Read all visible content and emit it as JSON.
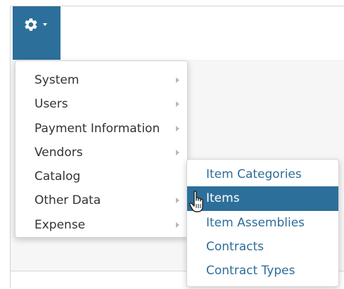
{
  "toolbar": {
    "settings_icon": "gear-icon",
    "dropdown_icon": "caret-down-icon",
    "accent_color": "#2c6f9a"
  },
  "main_menu": {
    "items": [
      {
        "label": "System",
        "has_submenu": true
      },
      {
        "label": "Users",
        "has_submenu": true
      },
      {
        "label": "Payment Information",
        "has_submenu": true
      },
      {
        "label": "Vendors",
        "has_submenu": true
      },
      {
        "label": "Catalog",
        "has_submenu": false,
        "expanded": true
      },
      {
        "label": "Other Data",
        "has_submenu": true
      },
      {
        "label": "Expense",
        "has_submenu": true
      }
    ]
  },
  "submenu": {
    "parent": "Catalog",
    "items": [
      {
        "label": "Item Categories",
        "highlighted": false
      },
      {
        "label": "Items",
        "highlighted": true
      },
      {
        "label": "Item Assemblies",
        "highlighted": false
      },
      {
        "label": "Contracts",
        "highlighted": false
      },
      {
        "label": "Contract Types",
        "highlighted": false
      }
    ]
  },
  "pointer": {
    "icon": "hand-pointer-icon"
  }
}
